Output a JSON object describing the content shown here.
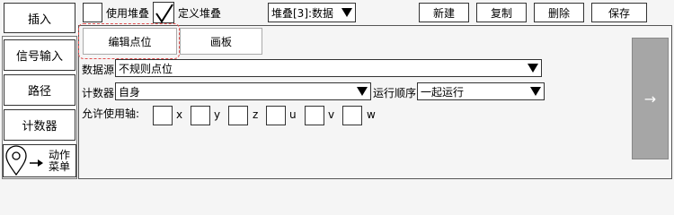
{
  "sidebar": {
    "insert": "插入",
    "signal_input": "信号输入",
    "path": "路径",
    "counter": "计数器",
    "action_menu_line1": "动作",
    "action_menu_line2": "菜单"
  },
  "toolbar": {
    "use_stack_label": "使用堆叠",
    "use_stack_checked": false,
    "define_stack_label": "定义堆叠",
    "define_stack_checked": true,
    "stack_select": "堆叠[3]:数据",
    "new": "新建",
    "copy": "复制",
    "delete": "删除",
    "save": "保存"
  },
  "tabs": {
    "edit_points": "编辑点位",
    "canvas": "画板"
  },
  "form": {
    "data_source_label": "数据源",
    "data_source_value": "不规则点位",
    "counter_label": "计数器",
    "counter_value": "自身",
    "run_order_label": "运行顺序",
    "run_order_value": "一起运行",
    "allowed_axes_label": "允许使用轴:",
    "axes": [
      "x",
      "y",
      "z",
      "u",
      "v",
      "w"
    ]
  },
  "next_arrow": "→",
  "colors": {
    "next_panel": "#a6a6a6",
    "highlight_border": "#e05050"
  }
}
